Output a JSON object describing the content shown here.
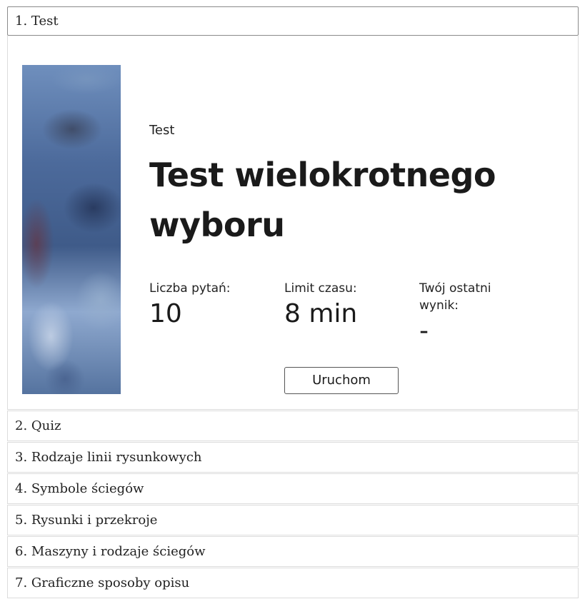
{
  "accordion": {
    "open_item": {
      "label": "1. Test"
    },
    "panel": {
      "kind": "Test",
      "title": "Test wielokrotnego wyboru",
      "stats": [
        {
          "label": "Liczba pytań:",
          "value": "10"
        },
        {
          "label": "Limit czasu:",
          "value": "8 min"
        },
        {
          "label": "Twój ostatni wynik:",
          "value": "-"
        }
      ],
      "start_label": "Uruchom"
    },
    "items": [
      {
        "label": "2. Quiz"
      },
      {
        "label": "3. Rodzaje linii rysunkowych"
      },
      {
        "label": "4. Symbole ściegów"
      },
      {
        "label": "5. Rysunki i przekroje"
      },
      {
        "label": "6. Maszyny i rodzaje ściegów"
      },
      {
        "label": "7. Graficzne sposoby opisu"
      }
    ]
  }
}
